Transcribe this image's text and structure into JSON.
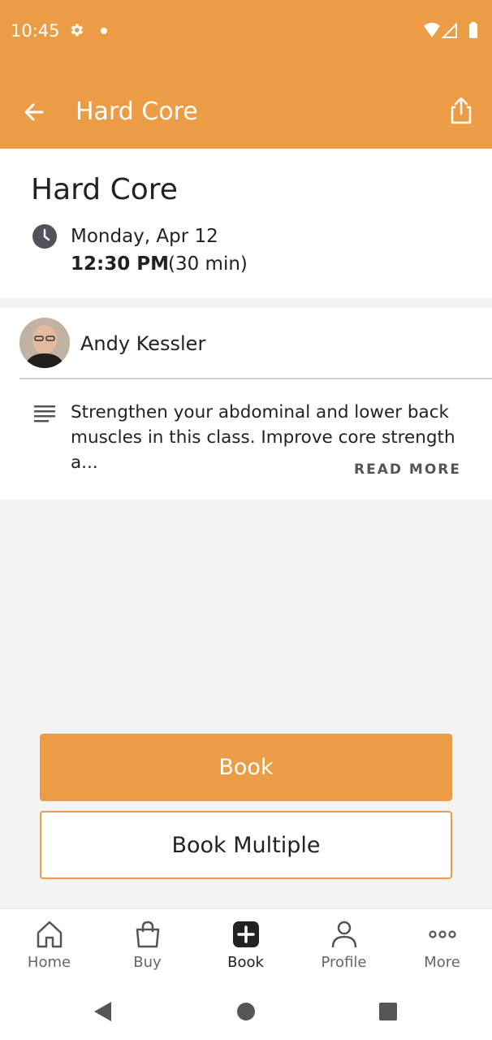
{
  "status_bar": {
    "time": "10:45"
  },
  "app_bar": {
    "title": "Hard Core"
  },
  "class_info": {
    "title": "Hard Core",
    "date": "Monday, Apr 12",
    "time": "12:30 PM",
    "duration": "(30 min)"
  },
  "instructor": {
    "name": "Andy Kessler"
  },
  "description": {
    "text": "Strengthen your abdominal and lower back muscles in this class. Improve core strength a...",
    "read_more": "READ MORE"
  },
  "actions": {
    "book": "Book",
    "book_multiple": "Book Multiple"
  },
  "bottom_nav": {
    "items": [
      {
        "label": "Home",
        "icon": "home-icon"
      },
      {
        "label": "Buy",
        "icon": "shopping-bag-icon"
      },
      {
        "label": "Book",
        "icon": "plus-square-icon",
        "active": true
      },
      {
        "label": "Profile",
        "icon": "person-icon"
      },
      {
        "label": "More",
        "icon": "more-dots-icon"
      }
    ]
  },
  "colors": {
    "accent": "#eb9c45",
    "background": "#f4f4f6"
  }
}
